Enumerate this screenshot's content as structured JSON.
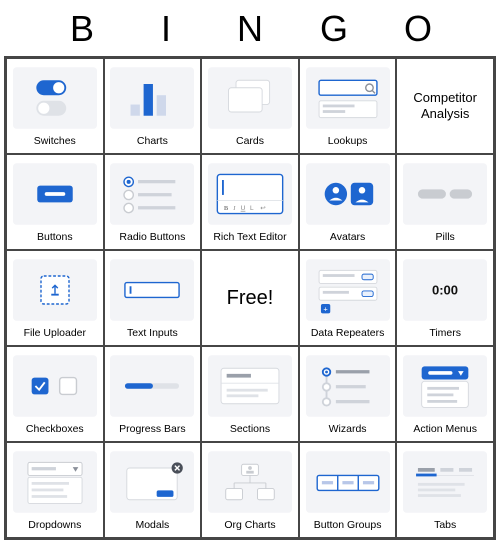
{
  "header_letters": [
    "B",
    "I",
    "N",
    "G",
    "O"
  ],
  "free_label": "Free!",
  "cells": [
    [
      {
        "icon": "switches",
        "label": "Switches"
      },
      {
        "icon": "charts",
        "label": "Charts"
      },
      {
        "icon": "cards",
        "label": "Cards"
      },
      {
        "icon": "lookups",
        "label": "Lookups"
      },
      {
        "text_only": "Competitor Analysis"
      }
    ],
    [
      {
        "icon": "buttons",
        "label": "Buttons"
      },
      {
        "icon": "radio",
        "label": "Radio Buttons"
      },
      {
        "icon": "rte",
        "label": "Rich Text Editor"
      },
      {
        "icon": "avatars",
        "label": "Avatars"
      },
      {
        "icon": "pills",
        "label": "Pills"
      }
    ],
    [
      {
        "icon": "uploader",
        "label": "File Uploader"
      },
      {
        "icon": "textinput",
        "label": "Text Inputs"
      },
      {
        "free": true
      },
      {
        "icon": "repeaters",
        "label": "Data Repeaters"
      },
      {
        "icon": "timers",
        "label": "Timers"
      }
    ],
    [
      {
        "icon": "checkboxes",
        "label": "Checkboxes"
      },
      {
        "icon": "progress",
        "label": "Progress Bars"
      },
      {
        "icon": "sections",
        "label": "Sections"
      },
      {
        "icon": "wizards",
        "label": "Wizards"
      },
      {
        "icon": "actionmenus",
        "label": "Action Menus"
      }
    ],
    [
      {
        "icon": "dropdowns",
        "label": "Dropdowns"
      },
      {
        "icon": "modals",
        "label": "Modals"
      },
      {
        "icon": "orgcharts",
        "label": "Org Charts"
      },
      {
        "icon": "buttongroups",
        "label": "Button Groups"
      },
      {
        "icon": "tabs",
        "label": "Tabs"
      }
    ]
  ],
  "colors": {
    "accent": "#1e66d0",
    "light": "#f3f4f7",
    "grey": "#c9ccd1"
  }
}
